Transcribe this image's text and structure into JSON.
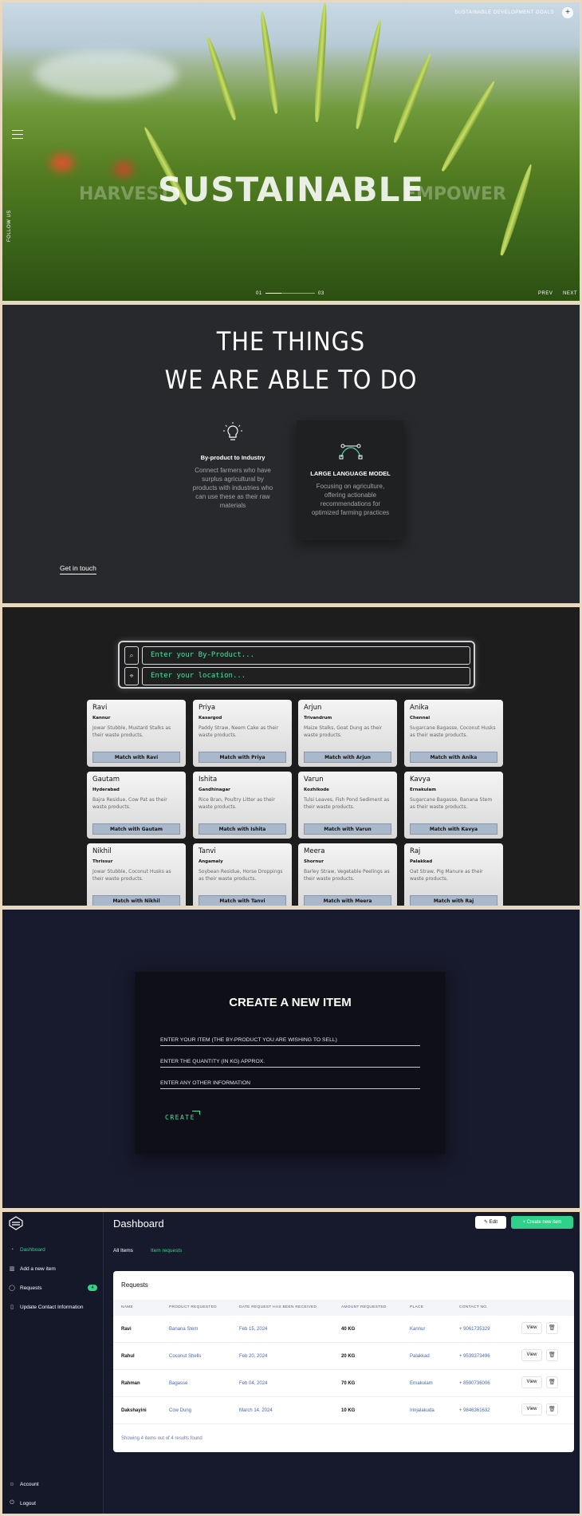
{
  "hero": {
    "main_word": "SUSTAINABLE",
    "ghost_left": "HARVEST",
    "ghost_right": "EMPOWER",
    "top_link": "SUSTAINABLE DEVELOPMENT GOALS",
    "follow": "FOLLOW US",
    "slide_from": "01",
    "slide_to": "03",
    "prev": "PREV",
    "next": "NEXT"
  },
  "things": {
    "heading_line1": "THE THINGS",
    "heading_line2": "WE ARE ABLE TO DO",
    "cards": [
      {
        "icon": "lightbulb-icon",
        "title": "By-product to Industry",
        "text": "Connect farmers who have surplus agricultural by products with industries who can use these as their raw materials"
      },
      {
        "icon": "bezier-curve-icon",
        "title": "LARGE LANGUAGE MODEL",
        "text": "Focusing on agriculture, offering actionable recommendations for optimized farming practices"
      }
    ],
    "cta": "Get in touch"
  },
  "matcher": {
    "byproduct_placeholder": "Enter your By-Product...",
    "location_placeholder": "Enter your location...",
    "profiles": [
      {
        "name": "Ravi",
        "city": "Kannur",
        "waste": "Jowar Stubble, Mustard Stalks as their waste products.",
        "button": "Match with Ravi"
      },
      {
        "name": "Priya",
        "city": "Kasargod",
        "waste": "Paddy Straw, Neem Cake as their waste products.",
        "button": "Match with Priya"
      },
      {
        "name": "Arjun",
        "city": "Trivandrum",
        "waste": "Maize Stalks, Goat Dung as their waste products.",
        "button": "Match with Arjun"
      },
      {
        "name": "Anika",
        "city": "Chennai",
        "waste": "Sugarcane Bagasse, Coconut Husks as their waste products.",
        "button": "Match with Anika"
      },
      {
        "name": "Gautam",
        "city": "Hyderabad",
        "waste": "Bajra Residue, Cow Pat as their waste products.",
        "button": "Match with Gautam"
      },
      {
        "name": "Ishita",
        "city": "Gandhinagar",
        "waste": "Rice Bran, Poultry Litter as their waste products.",
        "button": "Match with Ishita"
      },
      {
        "name": "Varun",
        "city": "Kozhikode",
        "waste": "Tulsi Leaves, Fish Pond Sediment as their waste products.",
        "button": "Match with Varun"
      },
      {
        "name": "Kavya",
        "city": "Ernakulam",
        "waste": "Sugarcane Bagasse, Banana Stem as their waste products.",
        "button": "Match with Kavya"
      },
      {
        "name": "Nikhil",
        "city": "Thrissur",
        "waste": "Jowar Stubble, Coconut Husks as their waste products.",
        "button": "Match with Nikhil"
      },
      {
        "name": "Tanvi",
        "city": "Angamaly",
        "waste": "Soybean Residue, Horse Droppings as their waste products.",
        "button": "Match with Tanvi"
      },
      {
        "name": "Meera",
        "city": "Shornur",
        "waste": "Barley Straw, Vegetable Peelings as their waste products.",
        "button": "Match with Meera"
      },
      {
        "name": "Raj",
        "city": "Palakkad",
        "waste": "Oat Straw, Pig Manure as their waste products.",
        "button": "Match with Raj"
      }
    ]
  },
  "create": {
    "title": "CREATE A NEW ITEM",
    "field_item": "ENTER YOUR ITEM (THE BY-PRODUCT YOU ARE WISHING TO SELL)",
    "field_qty": "ENTER THE QUANTITY (IN KG) APPROX.",
    "field_info": "ENTER ANY OTHER INFORMATION",
    "button": "CREATE"
  },
  "dashboard": {
    "title": "Dashboard",
    "edit": "Edit",
    "create_new": "Create new item",
    "tab_all": "All Items",
    "tab_requests": "Item requests",
    "sidebar": {
      "dashboard": "Dashboard",
      "add": "Add a new item",
      "requests": "Requests",
      "requests_count": "4",
      "update": "Update Contact Information",
      "account": "Account",
      "logout": "Logout"
    },
    "card_title": "Requests",
    "columns": [
      "NAME",
      "PRODUCT REQUESTED",
      "DATE REQUEST HAS BEEN RECEIVED",
      "AMOUNT REQUESTED",
      "PLACE",
      "CONTACT NO."
    ],
    "rows": [
      {
        "name": "Ravi",
        "product": "Banana Stem",
        "date": "Feb 15, 2024",
        "amount": "40 KG",
        "place": "Kannur",
        "contact": "+ 9061735329",
        "view": "View"
      },
      {
        "name": "Rahul",
        "product": "Coconut Shells",
        "date": "Feb 20, 2024",
        "amount": "20 KG",
        "place": "Palakkad",
        "contact": "+ 9539373496",
        "view": "View"
      },
      {
        "name": "Rahman",
        "product": "Bagasse",
        "date": "Feb 04, 2024",
        "amount": "70 KG",
        "place": "Ernakulam",
        "contact": "+ 8590736006",
        "view": "View"
      },
      {
        "name": "Dakshayini",
        "product": "Cow Dung",
        "date": "March 14, 2024",
        "amount": "10 KG",
        "place": "Irinjalakuda",
        "contact": "+ 9846361632",
        "view": "View"
      }
    ],
    "footer": "Showing 4 items out of 4 results found"
  }
}
